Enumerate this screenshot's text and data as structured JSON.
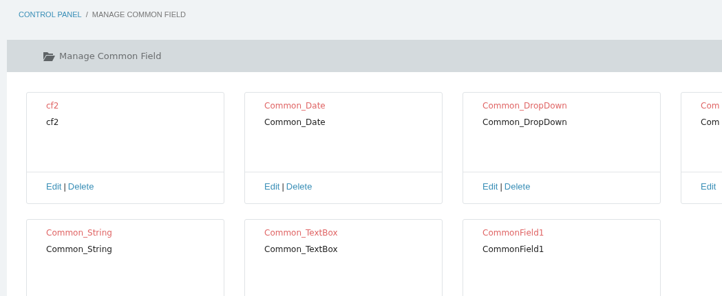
{
  "breadcrumb": [
    {
      "label": "CONTROL PANEL",
      "kind": "link"
    },
    {
      "label": "/",
      "kind": "separator"
    },
    {
      "label": "MANAGE COMMON FIELD",
      "kind": "current"
    }
  ],
  "panel": {
    "title": "Manage Common Field"
  },
  "cards": [
    {
      "title": "cf2",
      "value": "cf2",
      "actions": [
        "Edit",
        "|",
        "Delete"
      ]
    },
    {
      "title": "Common_Date",
      "value": "Common_Date",
      "actions": [
        "Edit",
        "|",
        "Delete"
      ]
    },
    {
      "title": "Common_DropDown",
      "value": "Common_DropDown",
      "actions": [
        "Edit",
        "|",
        "Delete"
      ]
    },
    {
      "title": "Com",
      "value": "Com",
      "actions": [
        "Edit"
      ]
    },
    {
      "title": "Common_String",
      "value": "Common_String"
    },
    {
      "title": "Common_TextBox",
      "value": "Common_TextBox"
    },
    {
      "title": "CommonField1",
      "value": "CommonField1"
    }
  ]
}
